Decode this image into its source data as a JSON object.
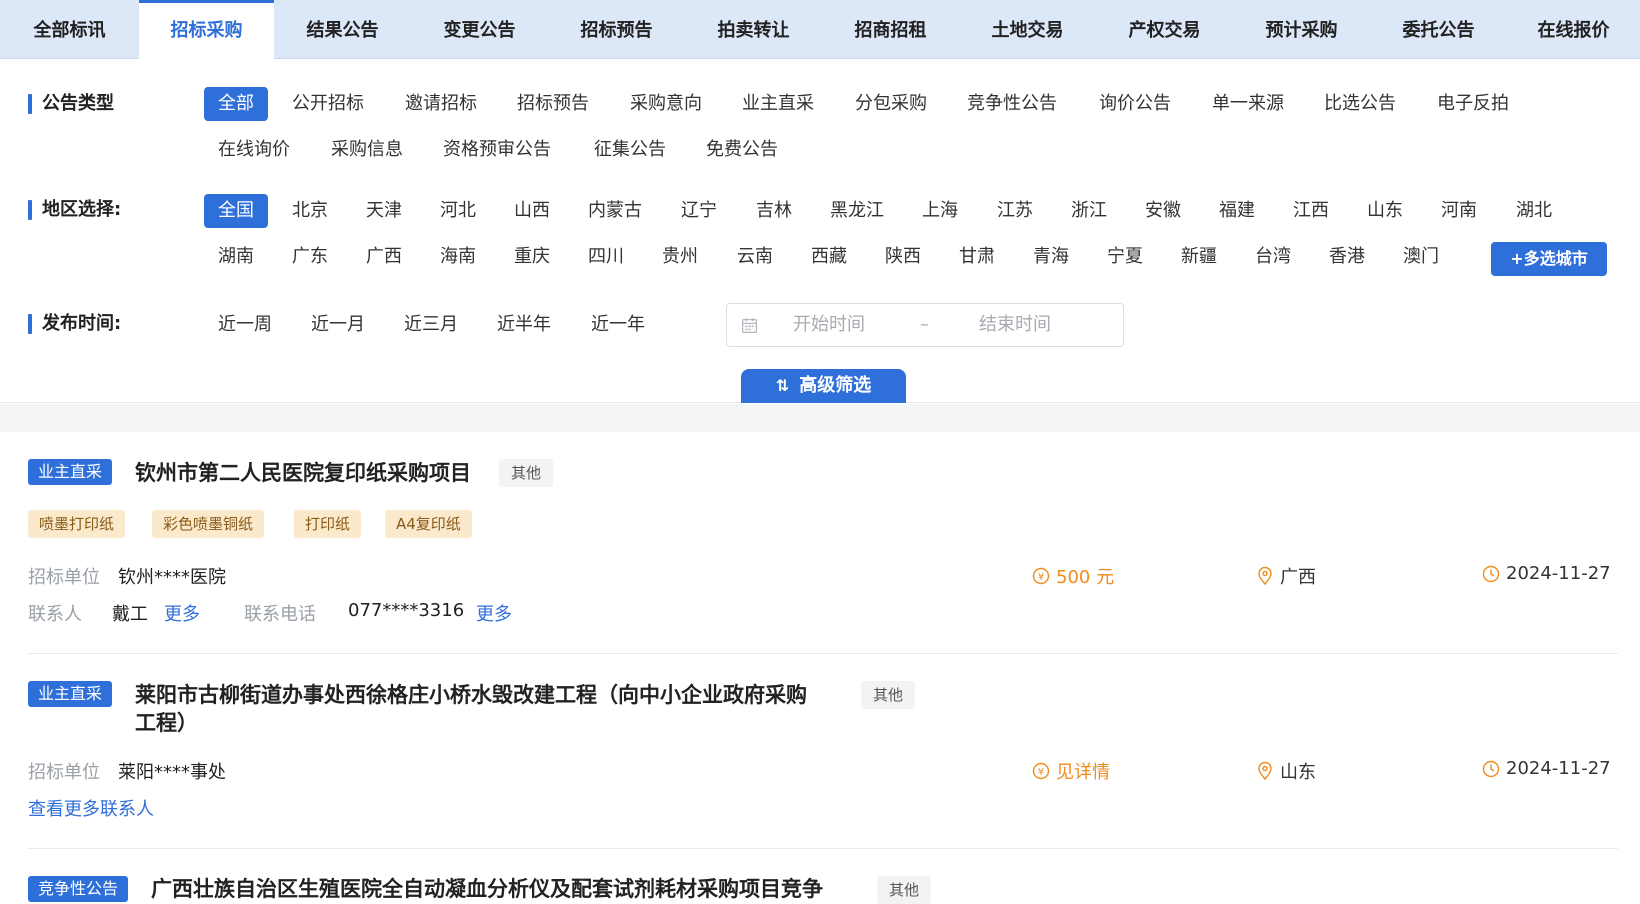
{
  "tabs": [
    "全部标讯",
    "招标采购",
    "结果公告",
    "变更公告",
    "招标预告",
    "拍卖转让",
    "招商招租",
    "土地交易",
    "产权交易",
    "预计采购",
    "委托公告",
    "在线报价"
  ],
  "active_tab": "招标采购",
  "filters": {
    "type_label": "公告类型",
    "types_row1": [
      "全部",
      "公开招标",
      "邀请招标",
      "招标预告",
      "采购意向",
      "业主直采",
      "分包采购",
      "竞争性公告",
      "询价公告",
      "单一来源",
      "比选公告",
      "电子反拍"
    ],
    "types_row2": [
      "在线询价",
      "采购信息",
      "资格预审公告",
      "征集公告",
      "免费公告"
    ],
    "region_label": "地区选择:",
    "regions_row1": [
      "全国",
      "北京",
      "天津",
      "河北",
      "山西",
      "内蒙古",
      "辽宁",
      "吉林",
      "黑龙江",
      "上海",
      "江苏",
      "浙江",
      "安徽",
      "福建",
      "江西",
      "山东",
      "河南",
      "湖北"
    ],
    "regions_row2": [
      "湖南",
      "广东",
      "广西",
      "海南",
      "重庆",
      "四川",
      "贵州",
      "云南",
      "西藏",
      "陕西",
      "甘肃",
      "青海",
      "宁夏",
      "新疆",
      "台湾",
      "香港",
      "澳门"
    ],
    "multi_city": "+多选城市",
    "time_label": "发布时间:",
    "time_opts": [
      "近一周",
      "近一月",
      "近三月",
      "近半年",
      "近一年"
    ],
    "start_placeholder": "开始时间",
    "end_placeholder": "结束时间",
    "range_sep": "–",
    "advanced": "高级筛选"
  },
  "results": [
    {
      "badge": "业主直采",
      "title": "钦州市第二人民医院复印纸采购项目",
      "category": "其他",
      "tags": [
        "喷墨打印纸",
        "彩色喷墨铜纸",
        "打印纸",
        "A4复印纸"
      ],
      "unit_label": "招标单位",
      "unit": "钦州****医院",
      "contact_label": "联系人",
      "contact": "戴工",
      "more": "更多",
      "phone_label": "联系电话",
      "phone": "077****3316",
      "phone_more": "更多",
      "amount": "500 元",
      "region": "广西",
      "date": "2024-11-27"
    },
    {
      "badge": "业主直采",
      "title_line1": "莱阳市古柳街道办事处西徐格庄小桥水毁改建工程（向中小企业政府采购",
      "title_line2": "工程）",
      "category": "其他",
      "unit_label": "招标单位",
      "unit": "莱阳****事处",
      "more_contacts": "查看更多联系人",
      "amount": "见详情",
      "region": "山东",
      "date": "2024-11-27"
    },
    {
      "badge": "竞争性公告",
      "title": "广西壮族自治区生殖医院全自动凝血分析仪及配套试剂耗材采购项目竞争",
      "category": "其他"
    }
  ],
  "colors": {
    "accent": "#2f6fd9",
    "money": "#f08b1d",
    "tag_bg": "#fbe9cc",
    "tab_bg": "#dce7f8"
  }
}
